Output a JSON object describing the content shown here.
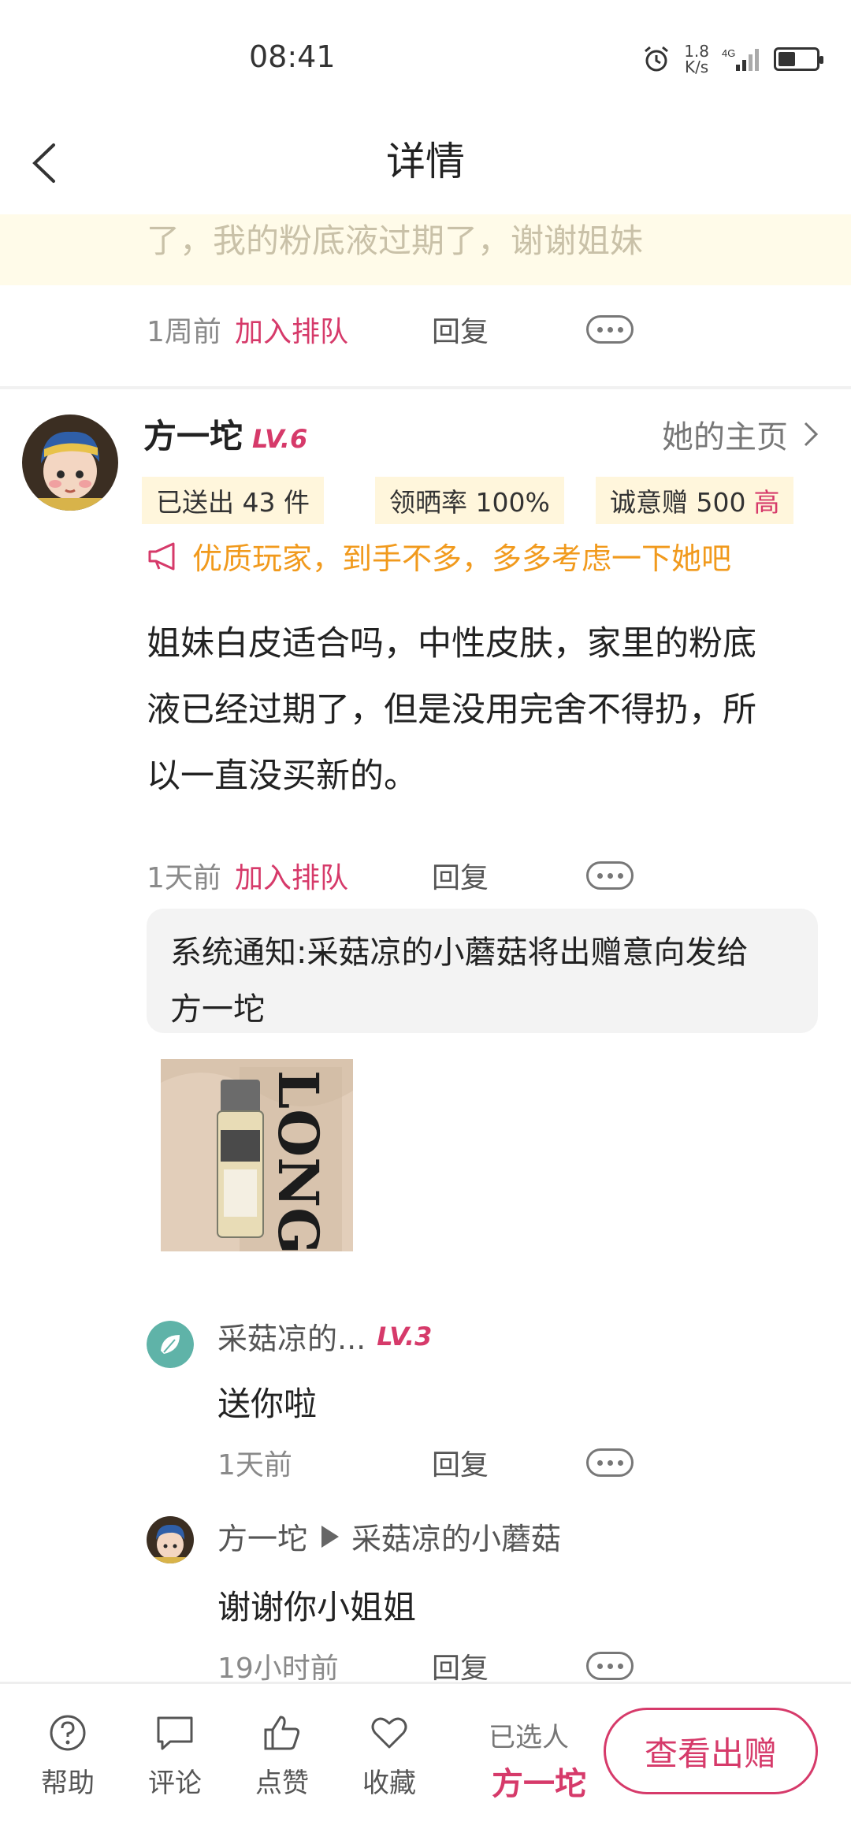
{
  "status_bar": {
    "time": "08:41",
    "net_speed_value": "1.8",
    "net_speed_unit": "K/s",
    "signal": "4G",
    "icons": [
      "alarm-icon",
      "signal-icon",
      "battery-icon"
    ],
    "battery_level": 0.45
  },
  "nav": {
    "title": "详情",
    "back_icon": "chevron-left-icon"
  },
  "prev_comment": {
    "text_tail": "了，我的粉底液过期了，谢谢姐妹",
    "time": "1周前",
    "queue_label": "加入排队",
    "reply_label": "回复"
  },
  "comment": {
    "user": {
      "name": "方一坨",
      "level": "LV.6",
      "homepage_label": "她的主页"
    },
    "stats": {
      "sent": "已送出 43 件",
      "claim_rate": "领晒率 100%",
      "sincerity": "诚意赠 500",
      "sincerity_level": "高"
    },
    "notice": "优质玩家，到手不多，多多考虑一下她吧",
    "body_lines": [
      "姐妹白皮适合吗，中性皮肤，家里的粉底",
      "液已经过期了，但是没用完舍不得扔，所",
      "以一直没买新的。"
    ],
    "time": "1天前",
    "queue_label": "加入排队",
    "reply_label": "回复",
    "system_notice_lines": [
      "系统通知:采菇凉的小蘑菇将出赠意向发给",
      "方一坨"
    ],
    "photo_text": "LONG"
  },
  "replies": [
    {
      "name": "采菇凉的...",
      "level": "LV.3",
      "text": "送你啦",
      "time": "1天前",
      "reply_label": "回复"
    },
    {
      "name": "方一坨",
      "to": "采菇凉的小蘑菇",
      "text": "谢谢你小姐姐",
      "time": "19小时前",
      "reply_label": "回复"
    }
  ],
  "bottom_bar": {
    "help": "帮助",
    "comment": "评论",
    "like": "点赞",
    "favorite": "收藏",
    "selected_label": "已选人",
    "selected_name": "方一坨",
    "view_button": "查看出赠"
  },
  "colors": {
    "accent": "#d63a6a",
    "notice": "#f19a1d",
    "tag_bg": "#fff6dc",
    "banner_bg": "#fffbe9"
  }
}
